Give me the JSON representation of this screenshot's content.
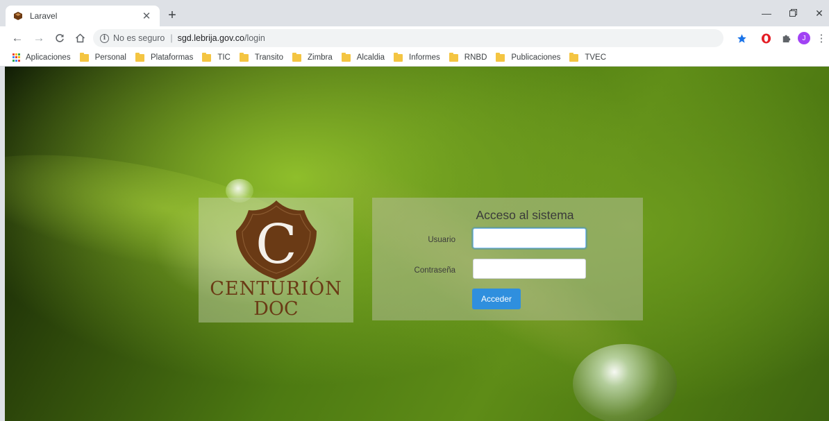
{
  "browser": {
    "tab": {
      "title": "Laravel"
    },
    "omnibox": {
      "security_label": "No es seguro",
      "separator": "|",
      "host": "sgd.lebrija.gov.co",
      "path": "/login"
    },
    "profile_initial": "J",
    "bookmarks": [
      {
        "label": "Aplicaciones",
        "icon": "apps-grid-icon"
      },
      {
        "label": "Personal",
        "icon": "folder-icon"
      },
      {
        "label": "Plataformas",
        "icon": "folder-icon"
      },
      {
        "label": "TIC",
        "icon": "folder-icon"
      },
      {
        "label": "Transito",
        "icon": "folder-icon"
      },
      {
        "label": "Zimbra",
        "icon": "folder-icon"
      },
      {
        "label": "Alcaldia",
        "icon": "folder-icon"
      },
      {
        "label": "Informes",
        "icon": "folder-icon"
      },
      {
        "label": "RNBD",
        "icon": "folder-icon"
      },
      {
        "label": "Publicaciones",
        "icon": "folder-icon"
      },
      {
        "label": "TVEC",
        "icon": "folder-icon"
      }
    ]
  },
  "page": {
    "logo": {
      "initial": "C",
      "line1": "CENTURIÓN",
      "line2": "DOC"
    },
    "login": {
      "title": "Acceso al sistema",
      "username_label": "Usuario",
      "username_value": "",
      "password_label": "Contraseña",
      "password_value": "",
      "submit_label": "Acceder"
    }
  },
  "colors": {
    "button": "#2f8fde",
    "brand_brown": "#6a3a15",
    "bookmark_folder": "#f4c542",
    "star": "#1a73e8",
    "profile": "#a142f4",
    "opera": "#e41e26"
  }
}
